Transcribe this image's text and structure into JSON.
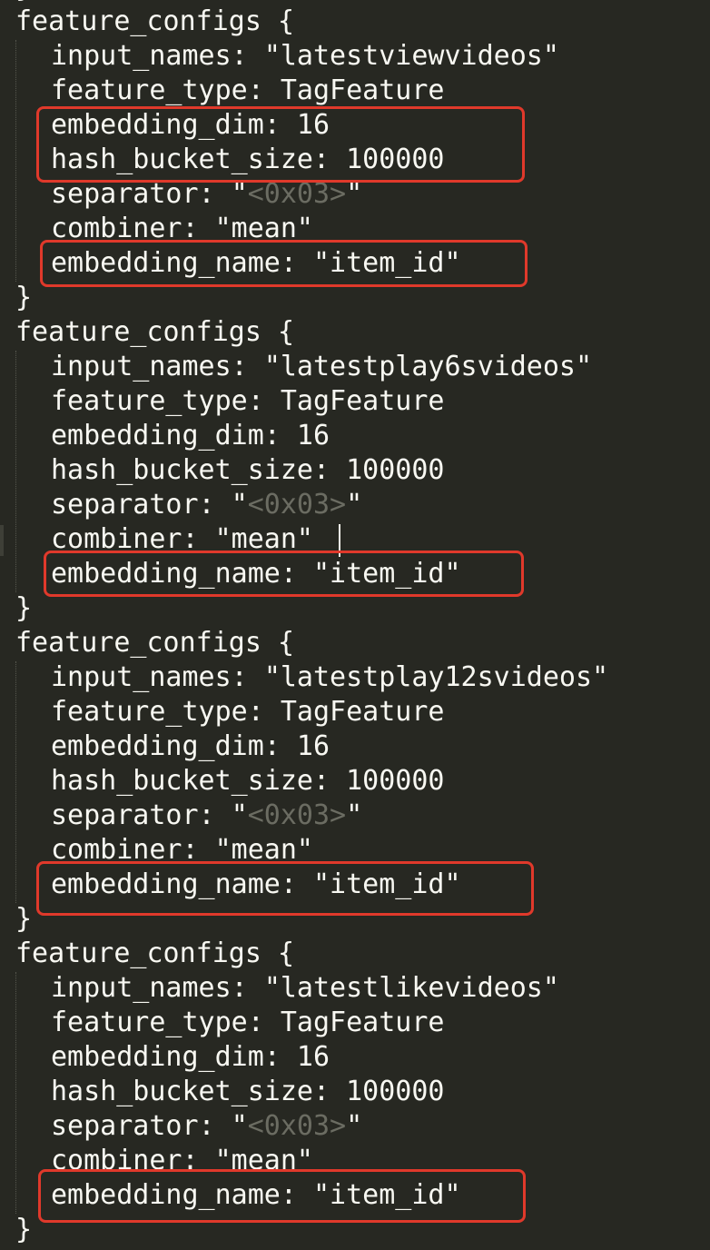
{
  "editor": {
    "blocks": [
      {
        "open": "feature_configs {",
        "input_names_key": "input_names: ",
        "input_names_value": "\"latestviewvideos\"",
        "feature_type": "feature_type: TagFeature",
        "embedding_dim": "embedding_dim: 16",
        "hash_bucket_size": "hash_bucket_size: 100000",
        "separator_key": "separator: ",
        "separator_quote_open": "\"",
        "separator_ctrl": "<0x03>",
        "separator_quote_close": "\"",
        "combiner": "combiner: \"mean\"",
        "embedding_name": "embedding_name: \"item_id\"",
        "close": "}"
      },
      {
        "open": "feature_configs {",
        "input_names_key": "input_names: ",
        "input_names_value": "\"latestplay6svideos\"",
        "feature_type": "feature_type: TagFeature",
        "embedding_dim": "embedding_dim: 16",
        "hash_bucket_size": "hash_bucket_size: 100000",
        "separator_key": "separator: ",
        "separator_quote_open": "\"",
        "separator_ctrl": "<0x03>",
        "separator_quote_close": "\"",
        "combiner": "combiner: \"mean\"",
        "embedding_name": "embedding_name: \"item_id\"",
        "close": "}"
      },
      {
        "open": "feature_configs {",
        "input_names_key": "input_names: ",
        "input_names_value": "\"latestplay12svideos\"",
        "feature_type": "feature_type: TagFeature",
        "embedding_dim": "embedding_dim: 16",
        "hash_bucket_size": "hash_bucket_size: 100000",
        "separator_key": "separator: ",
        "separator_quote_open": "\"",
        "separator_ctrl": "<0x03>",
        "separator_quote_close": "\"",
        "combiner": "combiner: \"mean\"",
        "embedding_name": "embedding_name: \"item_id\"",
        "close": "}"
      },
      {
        "open": "feature_configs {",
        "input_names_key": "input_names: ",
        "input_names_value": "\"latestlikevideos\"",
        "feature_type": "feature_type: TagFeature",
        "embedding_dim": "embedding_dim: 16",
        "hash_bucket_size": "hash_bucket_size: 100000",
        "separator_key": "separator: ",
        "separator_quote_open": "\"",
        "separator_ctrl": "<0x03>",
        "separator_quote_close": "\"",
        "combiner": "combiner: \"mean\"",
        "embedding_name": "embedding_name: \"item_id\"",
        "close": "}"
      }
    ],
    "colors": {
      "background": "#272822",
      "text": "#f8f8f2",
      "control_char": "#6b6c62",
      "highlight_box": "#e0392b"
    }
  }
}
